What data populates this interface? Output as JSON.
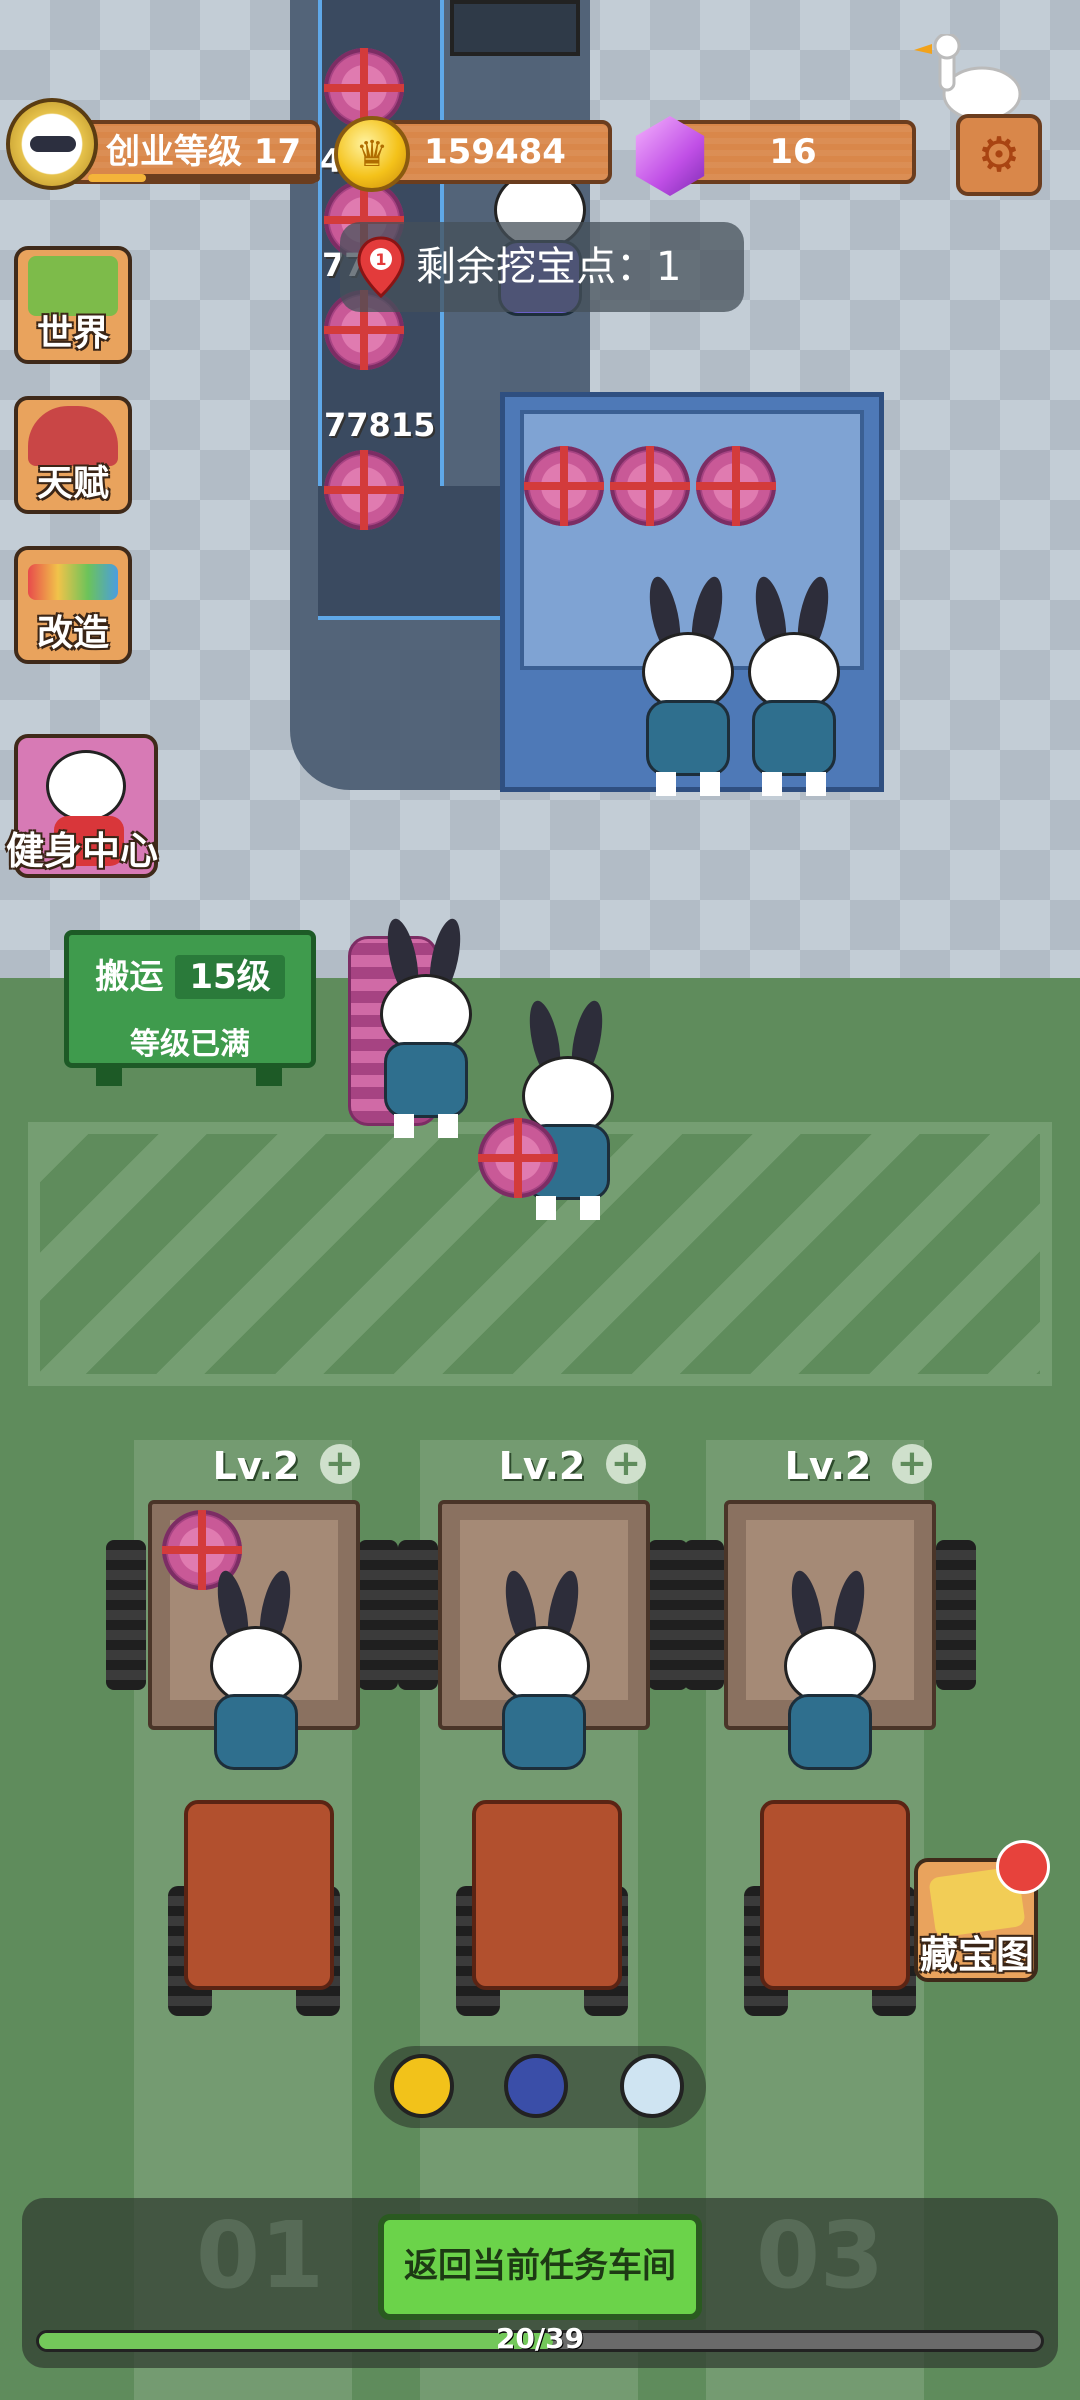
{
  "header": {
    "level_label": "创业等级 17",
    "level_progress": 0.25,
    "coins": "159484",
    "gems": "16"
  },
  "treasure": {
    "remaining_label": "剩余挖宝点：1",
    "pin_number": "1"
  },
  "side_menu": [
    {
      "label": "世界",
      "icon": "world-map-icon"
    },
    {
      "label": "天赋",
      "icon": "talent-icon"
    },
    {
      "label": "改造",
      "icon": "paint-roller-icon"
    },
    {
      "label": "健身中心",
      "icon": "gym-icon"
    }
  ],
  "belt": {
    "tally_1": "77815",
    "tally_partial": "77",
    "tally_left": "4"
  },
  "carry_sign": {
    "title": "搬运",
    "level": "15级",
    "status": "等级已满"
  },
  "stalls": [
    {
      "level": "Lv.2"
    },
    {
      "level": "Lv.2"
    },
    {
      "level": "Lv.2"
    }
  ],
  "treasure_map": {
    "label": "藏宝图"
  },
  "boosts": [
    "ticket-icon",
    "firecracker-icon",
    "money-bag-icon"
  ],
  "bottom": {
    "workshop_left": "01",
    "workshop_right": "03",
    "return_label": "返回当前任务车间",
    "progress_text": "20/39",
    "progress_value": 0.5128
  },
  "colors": {
    "accent_orange": "#d9874a",
    "accent_green": "#6bd34a",
    "gem_purple": "#c04fe6",
    "coin_gold": "#f4c21a"
  }
}
